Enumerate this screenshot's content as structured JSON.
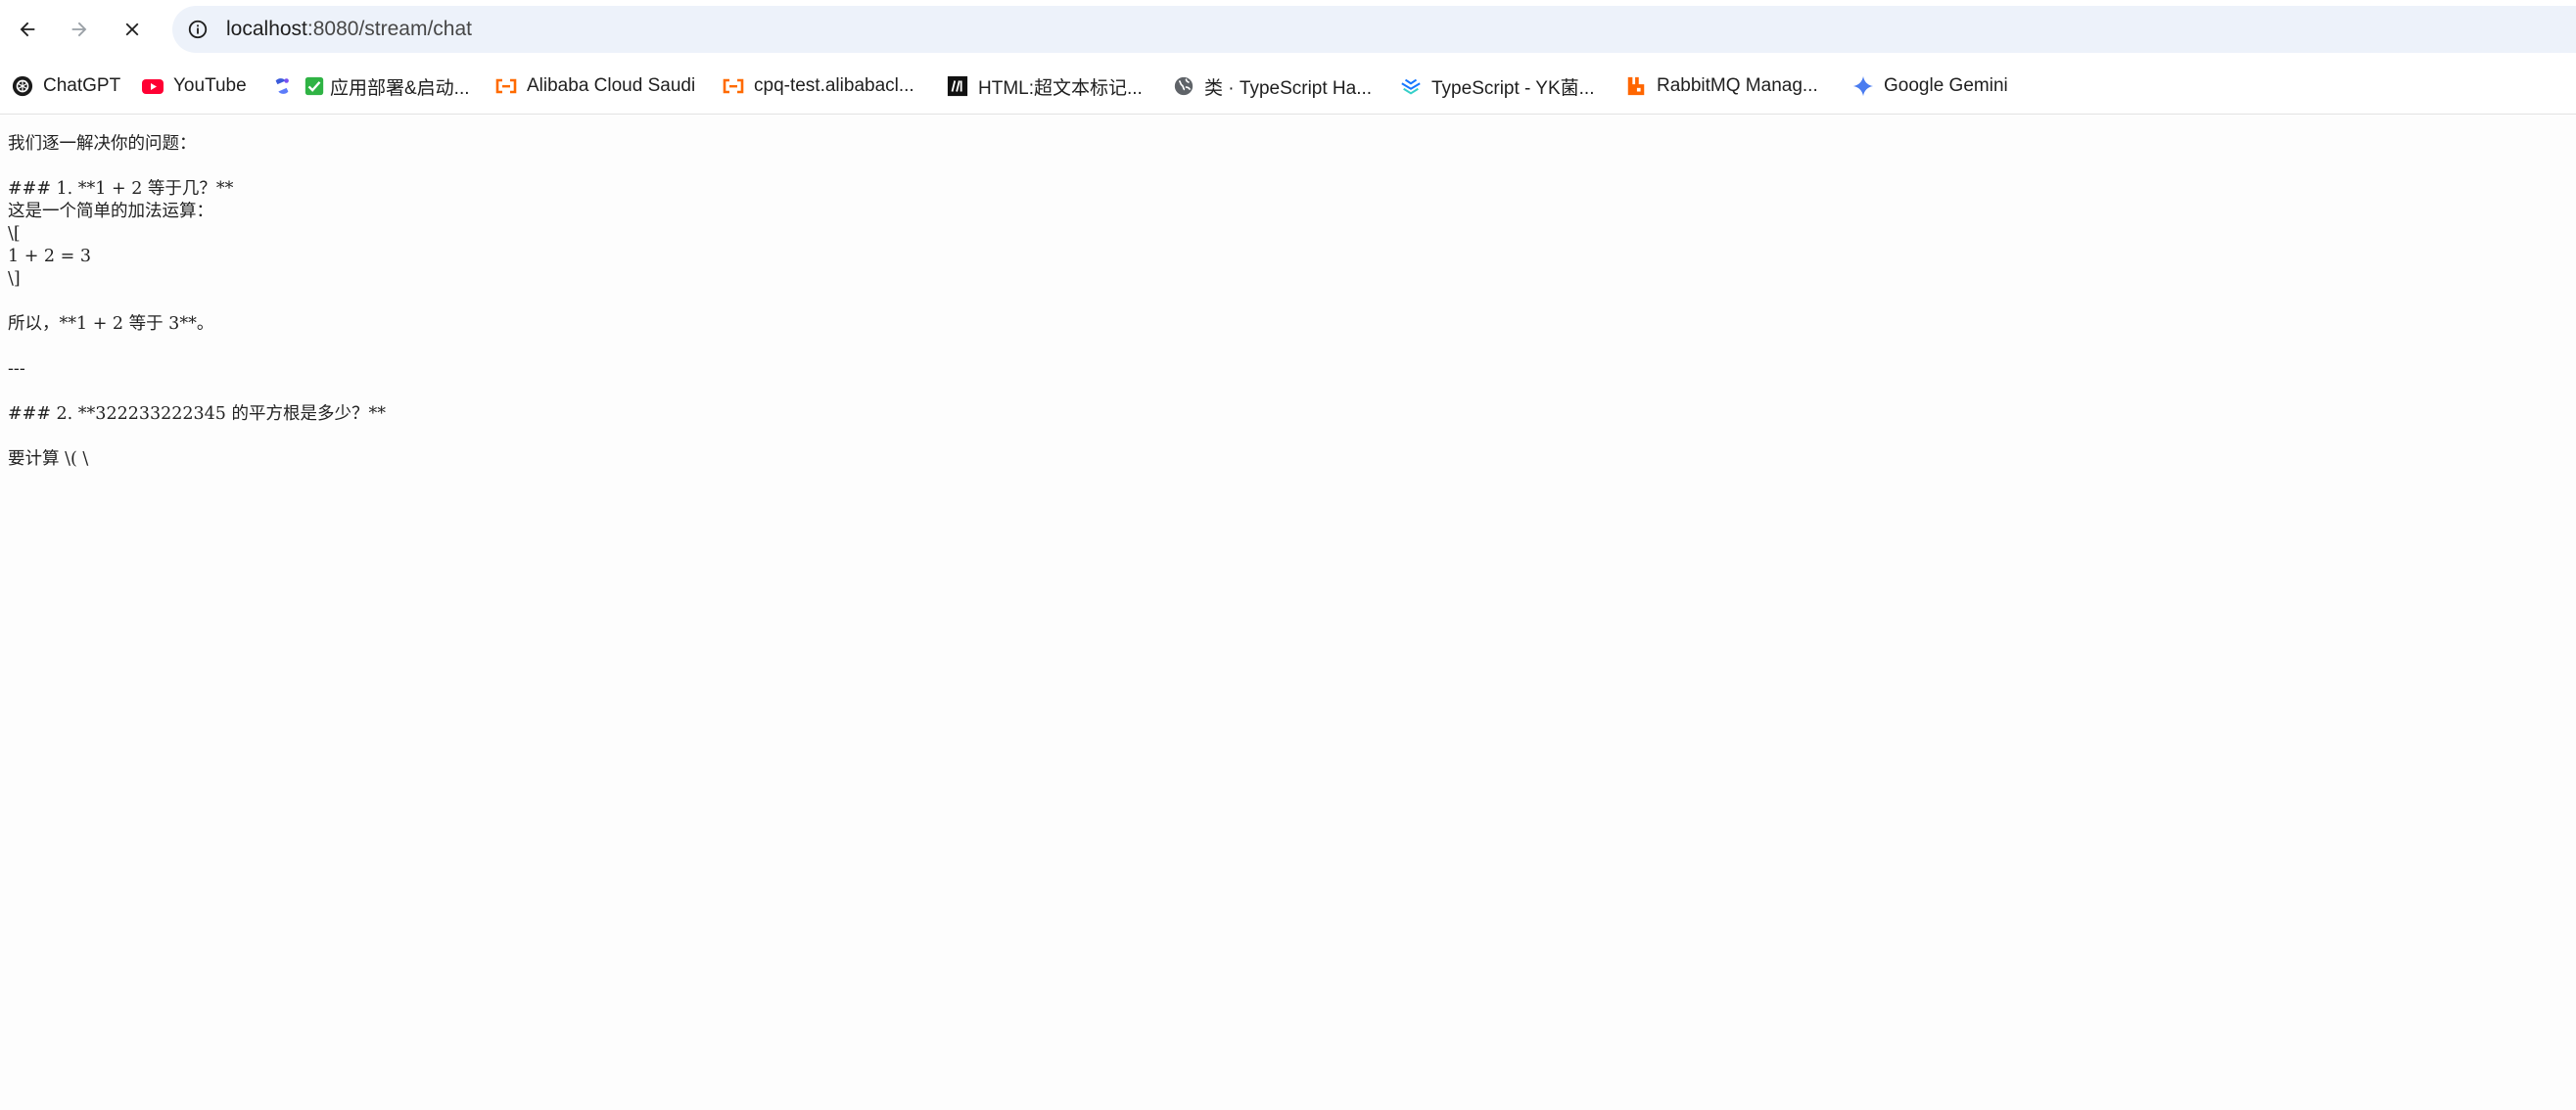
{
  "browser": {
    "url_host": "localhost",
    "url_path": ":8080/stream/chat",
    "nav": {
      "back_icon": "arrow-left-icon",
      "forward_icon": "arrow-right-icon",
      "stop_icon": "close-icon",
      "info_icon": "info-icon"
    }
  },
  "bookmarks": [
    {
      "label": "ChatGPT",
      "icon": "chatgpt-icon"
    },
    {
      "label": "YouTube",
      "icon": "youtube-icon"
    },
    {
      "label": "",
      "icon": "app-icon"
    },
    {
      "label": "应用部署&启动...",
      "icon": "checkbox-icon"
    },
    {
      "label": "Alibaba Cloud Saudi",
      "icon": "alibaba-cloud-icon"
    },
    {
      "label": "cpq-test.alibabacl...",
      "icon": "alibaba-cloud-icon"
    },
    {
      "label": "HTML:超文本标记...",
      "icon": "mdn-icon"
    },
    {
      "label": "类 · TypeScript Ha...",
      "icon": "globe-icon"
    },
    {
      "label": "TypeScript - YK菌...",
      "icon": "yuque-icon"
    },
    {
      "label": "RabbitMQ Manag...",
      "icon": "rabbitmq-icon"
    },
    {
      "label": "Google Gemini",
      "icon": "gemini-icon"
    }
  ],
  "content": {
    "text": "我们逐一解决你的问题：\n\n### 1. **1 + 2 等于几？**\n这是一个简单的加法运算：\n\\[\n1 + 2 = 3\n\\]\n\n所以，**1 + 2 等于 3**。\n\n---\n\n### 2. **322233222345 的平方根是多少？**\n\n要计算 \\( \\"
  }
}
